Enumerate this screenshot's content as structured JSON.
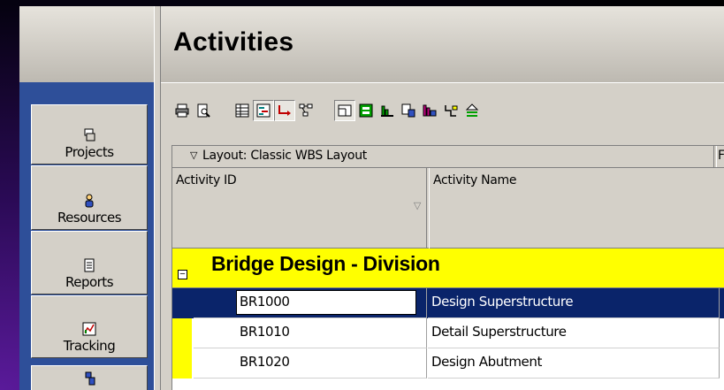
{
  "page": {
    "title": "Activities"
  },
  "sidebar": {
    "items": [
      {
        "label": "Projects",
        "icon": "projects-icon"
      },
      {
        "label": "Resources",
        "icon": "resources-icon"
      },
      {
        "label": "Reports",
        "icon": "reports-icon"
      },
      {
        "label": "Tracking",
        "icon": "tracking-icon"
      },
      {
        "label": "",
        "icon": "wbs-icon"
      }
    ]
  },
  "toolbar": {
    "buttons": [
      "print-icon",
      "print-preview-icon",
      "table-icon",
      "gantt-icon",
      "relationship-icon",
      "network-icon",
      "details-icon",
      "spreadsheet-icon",
      "resource-histogram-icon",
      "resource-usage-icon",
      "resource-profile-icon",
      "trace-logic-icon",
      "level-icon"
    ]
  },
  "grid": {
    "layout_label": "Layout: Classic WBS Layout",
    "right_label": "F",
    "columns": {
      "activity_id": "Activity ID",
      "activity_name": "Activity Name"
    },
    "group_title": "Bridge Design - Division",
    "rows": [
      {
        "id": "BR1000",
        "name": "Design Superstructure",
        "selected": true
      },
      {
        "id": "BR1010",
        "name": "Detail Superstructure",
        "selected": false
      },
      {
        "id": "BR1020",
        "name": "Design Abutment",
        "selected": false
      }
    ]
  },
  "colors": {
    "selection": "#0a246a",
    "group_band": "#ffff00",
    "sidebar": "#2e4f99"
  }
}
